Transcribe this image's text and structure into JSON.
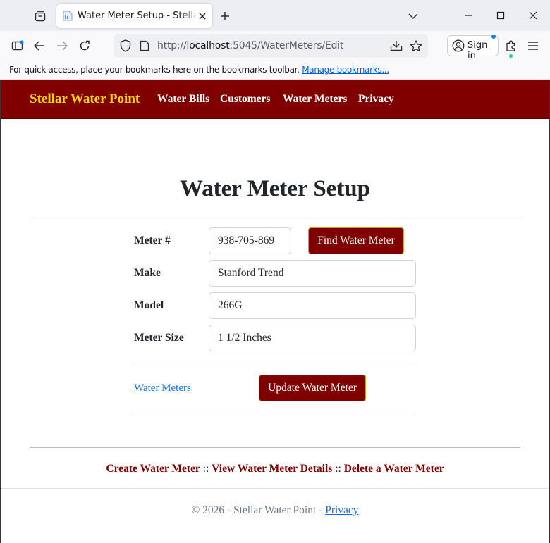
{
  "browser": {
    "tab_title": "Water Meter Setup - Stellar Water Point",
    "url_prefix": "http://",
    "url_host": "localhost",
    "url_rest": ":5045/WaterMeters/Edit",
    "sign_in_label": "Sign in",
    "bookmarks_message": "For quick access, place your bookmarks here on the bookmarks toolbar.",
    "bookmarks_link": "Manage bookmarks..."
  },
  "site_nav": {
    "brand": "Stellar Water Point",
    "links": [
      "Water Bills",
      "Customers",
      "Water Meters",
      "Privacy"
    ]
  },
  "page": {
    "title": "Water Meter Setup"
  },
  "form": {
    "meter_number_label": "Meter #",
    "meter_number_value": "938-705-869",
    "find_button": "Find Water Meter",
    "make_label": "Make",
    "make_value": "Stanford Trend",
    "model_label": "Model",
    "model_value": "266G",
    "meter_size_label": "Meter Size",
    "meter_size_value": "1 1/2 Inches",
    "back_link": "Water Meters",
    "update_button": "Update Water Meter"
  },
  "bottom_links": {
    "create": "Create Water Meter",
    "view": "View Water Meter Details",
    "delete": "Delete a Water Meter",
    "separator": "::"
  },
  "footer": {
    "copyright": "© 2026 - Stellar Water Point -",
    "privacy": "Privacy"
  },
  "colors": {
    "brand_maroon": "#800000",
    "brand_gold": "#ffd700",
    "link_blue": "#0d6efd"
  }
}
